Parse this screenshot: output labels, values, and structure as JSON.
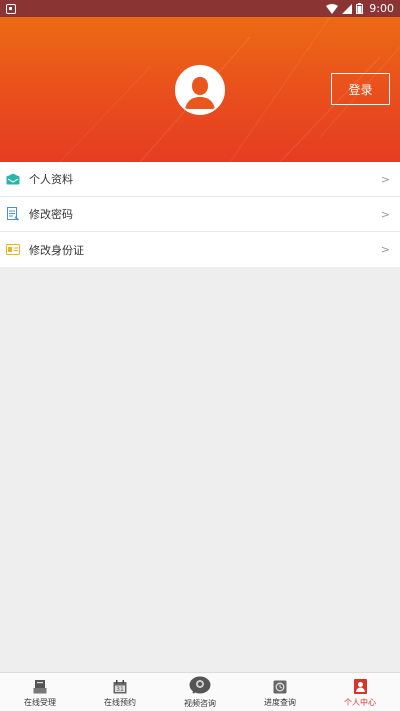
{
  "status_bar": {
    "time": "9:00"
  },
  "header": {
    "login_label": "登录"
  },
  "menu": {
    "items": [
      {
        "label": "个人资料",
        "icon": "profile-icon",
        "color": "#2bb5a8"
      },
      {
        "label": "修改密码",
        "icon": "password-doc-icon",
        "color": "#4a90d9"
      },
      {
        "label": "修改身份证",
        "icon": "id-card-icon",
        "color": "#e6b422"
      }
    ]
  },
  "bottom_nav": {
    "items": [
      {
        "label": "在线受理",
        "icon": "online-accept-icon",
        "active": false
      },
      {
        "label": "在线预约",
        "icon": "calendar-icon",
        "active": false
      },
      {
        "label": "视频咨询",
        "icon": "video-chat-icon",
        "active": false
      },
      {
        "label": "进度查询",
        "icon": "progress-query-icon",
        "active": false
      },
      {
        "label": "个人中心",
        "icon": "personal-center-icon",
        "active": true
      }
    ],
    "active_color": "#d9342b"
  },
  "colors": {
    "header_top": "#ec6a14",
    "header_bottom": "#e53d22",
    "status_bar": "#8a3434",
    "background": "#eeeeee"
  }
}
